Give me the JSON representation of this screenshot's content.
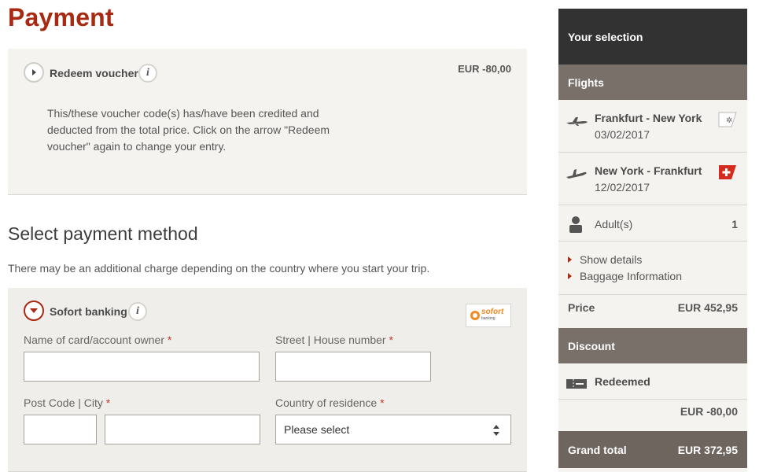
{
  "page": {
    "title": "Payment"
  },
  "voucher": {
    "heading": "Redeem voucher",
    "amount": "EUR  -80,00",
    "message": "This/these voucher code(s) has/have been credited and deducted from the total price. Click on the arrow \"Redeem voucher\" again to change your entry."
  },
  "payment": {
    "title": "Select payment method",
    "note": "There may be an additional charge depending on the country where you start your trip.",
    "method": {
      "heading": "Sofort banking",
      "logo_text": "sofort",
      "logo_sub": "banking",
      "fields": {
        "owner_label": "Name of card/account owner",
        "street_label": "Street | House number",
        "postcode_label": "Post Code | City",
        "country_label": "Country of residence",
        "country_value": "Please select",
        "required_mark": "*"
      }
    }
  },
  "sidebar": {
    "header": "Your selection",
    "flights_label": "Flights",
    "flights": [
      {
        "route": "Frankfurt - New York",
        "date": "03/02/2017"
      },
      {
        "route": "New York - Frankfurt",
        "date": "12/02/2017"
      }
    ],
    "passengers": {
      "label": "Adult(s)",
      "count": "1"
    },
    "links": {
      "details": "Show details",
      "baggage": "Baggage Information"
    },
    "price": {
      "label": "Price",
      "value": "EUR 452,95"
    },
    "discount": {
      "label": "Discount",
      "status": "Redeemed",
      "value": "EUR -80,00"
    },
    "grand_total": {
      "label": "Grand total",
      "value": "EUR 372,95"
    }
  },
  "colors": {
    "accent": "#a82a12",
    "band": "#7a706a",
    "header": "#323232",
    "grand": "#6e655f"
  }
}
